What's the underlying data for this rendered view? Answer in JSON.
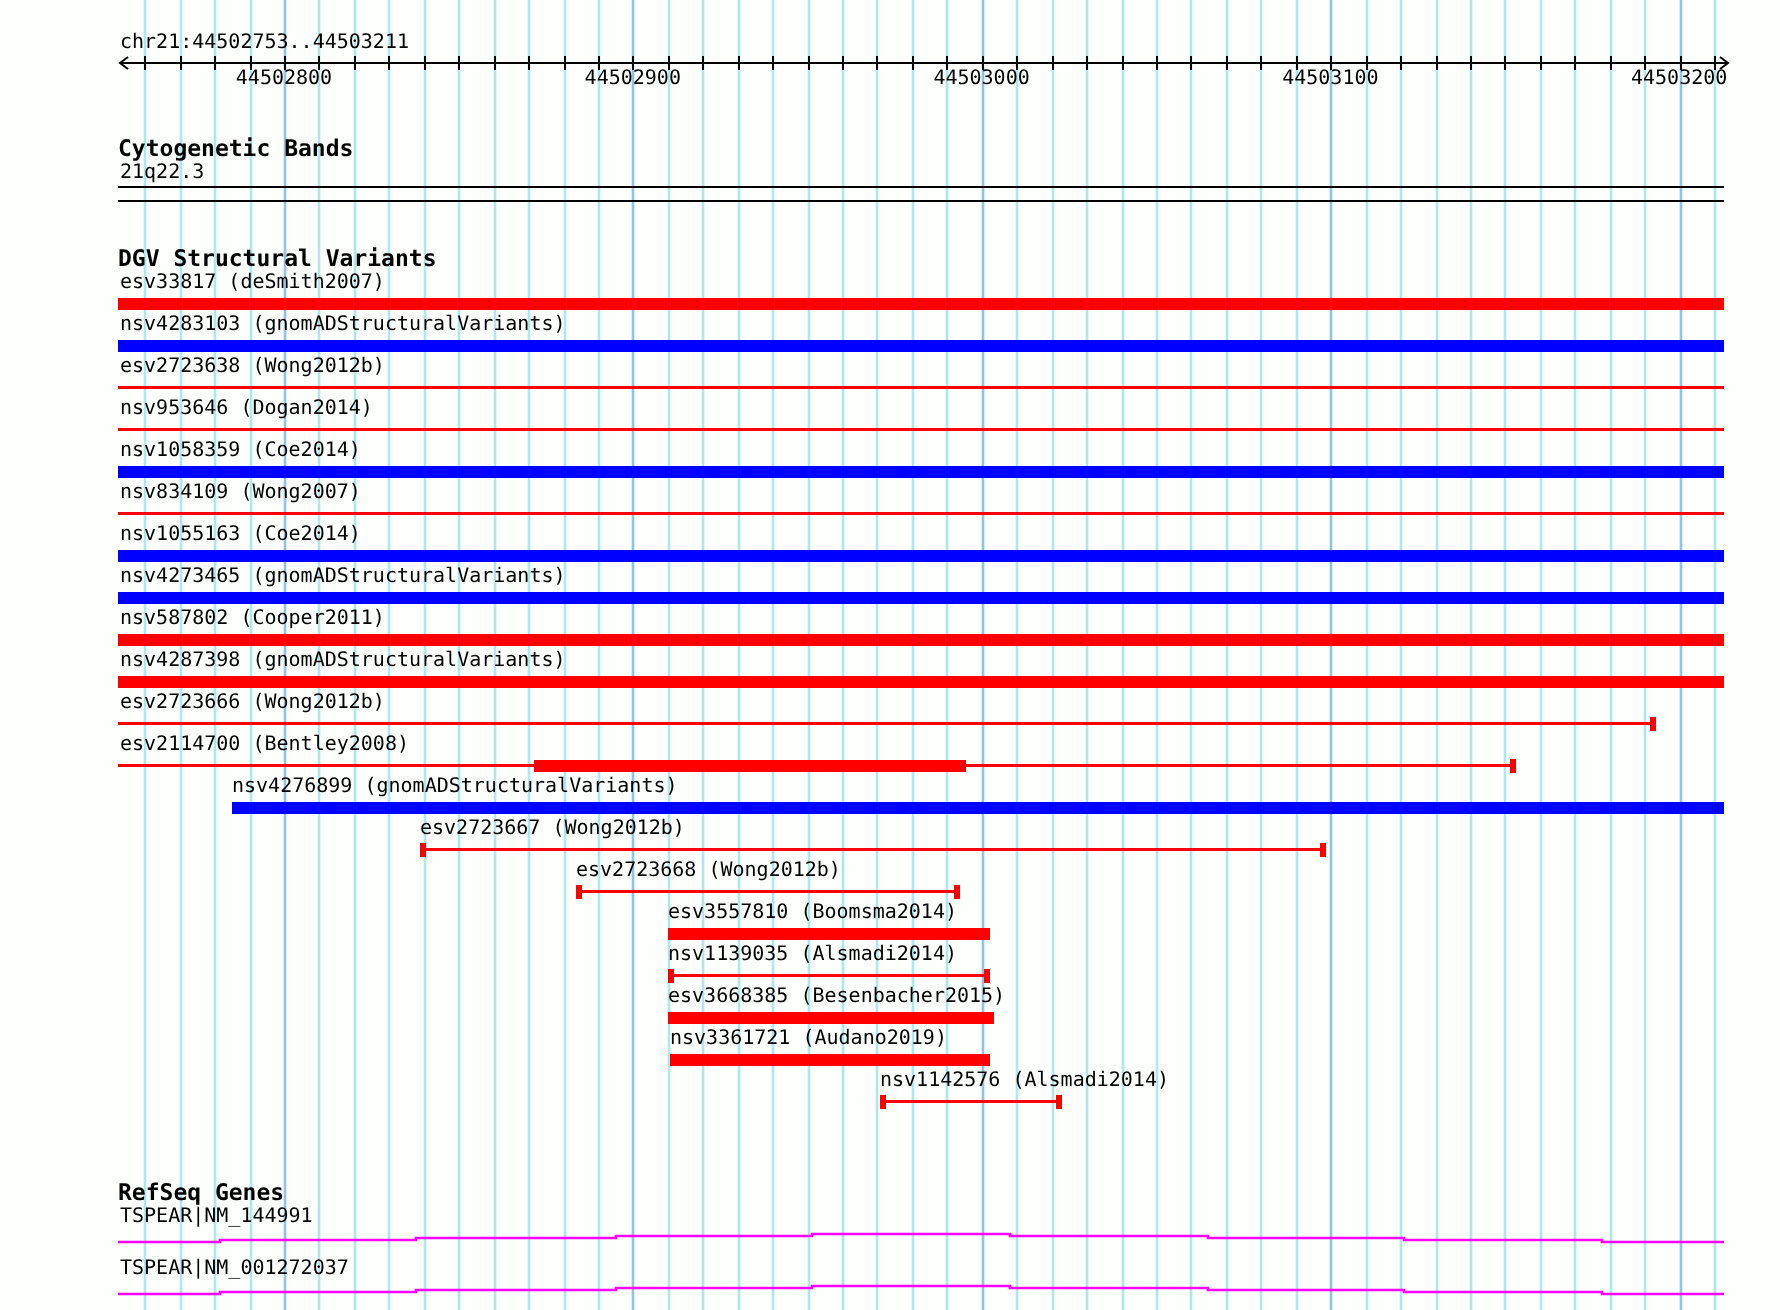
{
  "ruler": {
    "location": "chr21:44502753..44503211",
    "tick_labels": [
      "44502800",
      "44502900",
      "44503000",
      "44503100",
      "44503200"
    ]
  },
  "tracks": [
    {
      "kind": "bands",
      "title": "Cytogenetic Bands",
      "features": [
        {
          "label": "21q22.3"
        }
      ]
    },
    {
      "kind": "variants",
      "title": "DGV Structural Variants",
      "features": [
        {
          "label": "esv33817 (deSmith2007)",
          "kind": "bar",
          "color": "#ff0000"
        },
        {
          "label": "nsv4283103 (gnomADStructuralVariants)",
          "kind": "bar",
          "color": "#0000ff"
        },
        {
          "label": "esv2723638 (Wong2012b)",
          "kind": "line",
          "color": "#ff0000"
        },
        {
          "label": "nsv953646 (Dogan2014)",
          "kind": "line",
          "color": "#ff0000"
        },
        {
          "label": "nsv1058359 (Coe2014)",
          "kind": "bar",
          "color": "#0000ff"
        },
        {
          "label": "nsv834109 (Wong2007)",
          "kind": "line",
          "color": "#ff0000"
        },
        {
          "label": "nsv1055163 (Coe2014)",
          "kind": "bar",
          "color": "#0000ff"
        },
        {
          "label": "nsv4273465 (gnomADStructuralVariants)",
          "kind": "bar",
          "color": "#0000ff"
        },
        {
          "label": "nsv587802 (Cooper2011)",
          "kind": "bar",
          "color": "#ff0000"
        },
        {
          "label": "nsv4287398 (gnomADStructuralVariants)",
          "kind": "bar",
          "color": "#ff0000"
        },
        {
          "label": "esv2723666 (Wong2012b)",
          "kind": "line",
          "color": "#ff0000"
        },
        {
          "label": "esv2114700 (Bentley2008)",
          "kind": "mixed",
          "color": "#ff0000"
        },
        {
          "label": "nsv4276899 (gnomADStructuralVariants)",
          "kind": "bar",
          "color": "#0000ff"
        },
        {
          "label": "esv2723667 (Wong2012b)",
          "kind": "line",
          "color": "#ff0000"
        },
        {
          "label": "esv2723668 (Wong2012b)",
          "kind": "line",
          "color": "#ff0000"
        },
        {
          "label": "esv3557810 (Boomsma2014)",
          "kind": "bar",
          "color": "#ff0000"
        },
        {
          "label": "nsv1139035 (Alsmadi2014)",
          "kind": "line",
          "color": "#ff0000"
        },
        {
          "label": "esv3668385 (Besenbacher2015)",
          "kind": "bar",
          "color": "#ff0000"
        },
        {
          "label": "nsv3361721 (Audano2019)",
          "kind": "bar",
          "color": "#ff0000"
        },
        {
          "label": "nsv1142576 (Alsmadi2014)",
          "kind": "line",
          "color": "#ff0000"
        }
      ]
    },
    {
      "kind": "genes",
      "title": "RefSeq Genes",
      "features": [
        {
          "label": "TSPEAR|NM_144991"
        },
        {
          "label": "TSPEAR|NM_001272037"
        }
      ]
    }
  ]
}
